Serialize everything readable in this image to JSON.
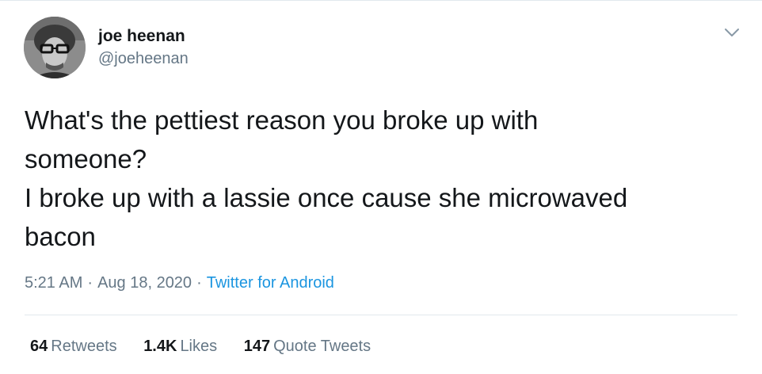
{
  "author": {
    "display_name": "joe heenan",
    "handle": "@joeheenan"
  },
  "tweet": {
    "text": "What's the pettiest reason you broke up with\nsomeone?\nI broke up with a lassie once cause she microwaved\nbacon",
    "time": "5:21 AM",
    "separator": "·",
    "date": "Aug 18, 2020",
    "source": "Twitter for Android"
  },
  "stats": {
    "retweets_count": "64",
    "retweets_label": "Retweets",
    "likes_count": "1.4K",
    "likes_label": "Likes",
    "quotes_count": "147",
    "quotes_label": "Quote Tweets"
  },
  "colors": {
    "text": "#14171a",
    "secondary": "#657786",
    "link": "#1b95e0",
    "divider": "#e1e8ed"
  },
  "icons": {
    "menu": "chevron-down-icon"
  }
}
